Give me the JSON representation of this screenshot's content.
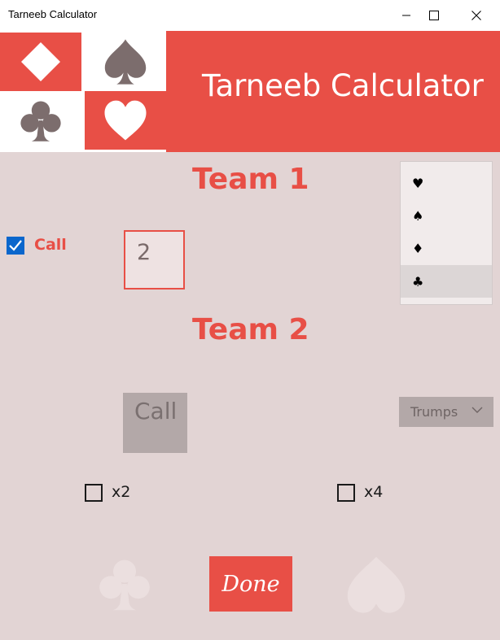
{
  "window": {
    "title": "Tarneeb Calculator"
  },
  "header": {
    "app_title": "Tarneeb Calculator",
    "suit_tiles": [
      "diamond",
      "spade",
      "club",
      "heart"
    ]
  },
  "colors": {
    "accent": "#e84f46",
    "background": "#e2d4d4",
    "suit_gray": "#7c6d6d",
    "checkbox_blue": "#0a66cc"
  },
  "team1": {
    "label": "Team 1",
    "call_checkbox": {
      "label": "Call",
      "checked": true
    },
    "bid_input": {
      "value": "2"
    }
  },
  "trump_list": {
    "items": [
      {
        "symbol": "♥",
        "icon": "heart-icon",
        "selected": false
      },
      {
        "symbol": "♠",
        "icon": "spade-icon",
        "selected": false
      },
      {
        "symbol": "♦",
        "icon": "diamond-icon",
        "selected": false
      },
      {
        "symbol": "♣",
        "icon": "club-icon",
        "selected": true
      }
    ]
  },
  "team2": {
    "label": "Team 2",
    "call_button": "Call",
    "trumps_dropdown": "Trumps",
    "x2": {
      "label": "x2",
      "checked": false
    },
    "x4": {
      "label": "x4",
      "checked": false
    }
  },
  "footer": {
    "done_button": "Done",
    "decor_icons": [
      "club-icon",
      "heart-icon"
    ]
  }
}
